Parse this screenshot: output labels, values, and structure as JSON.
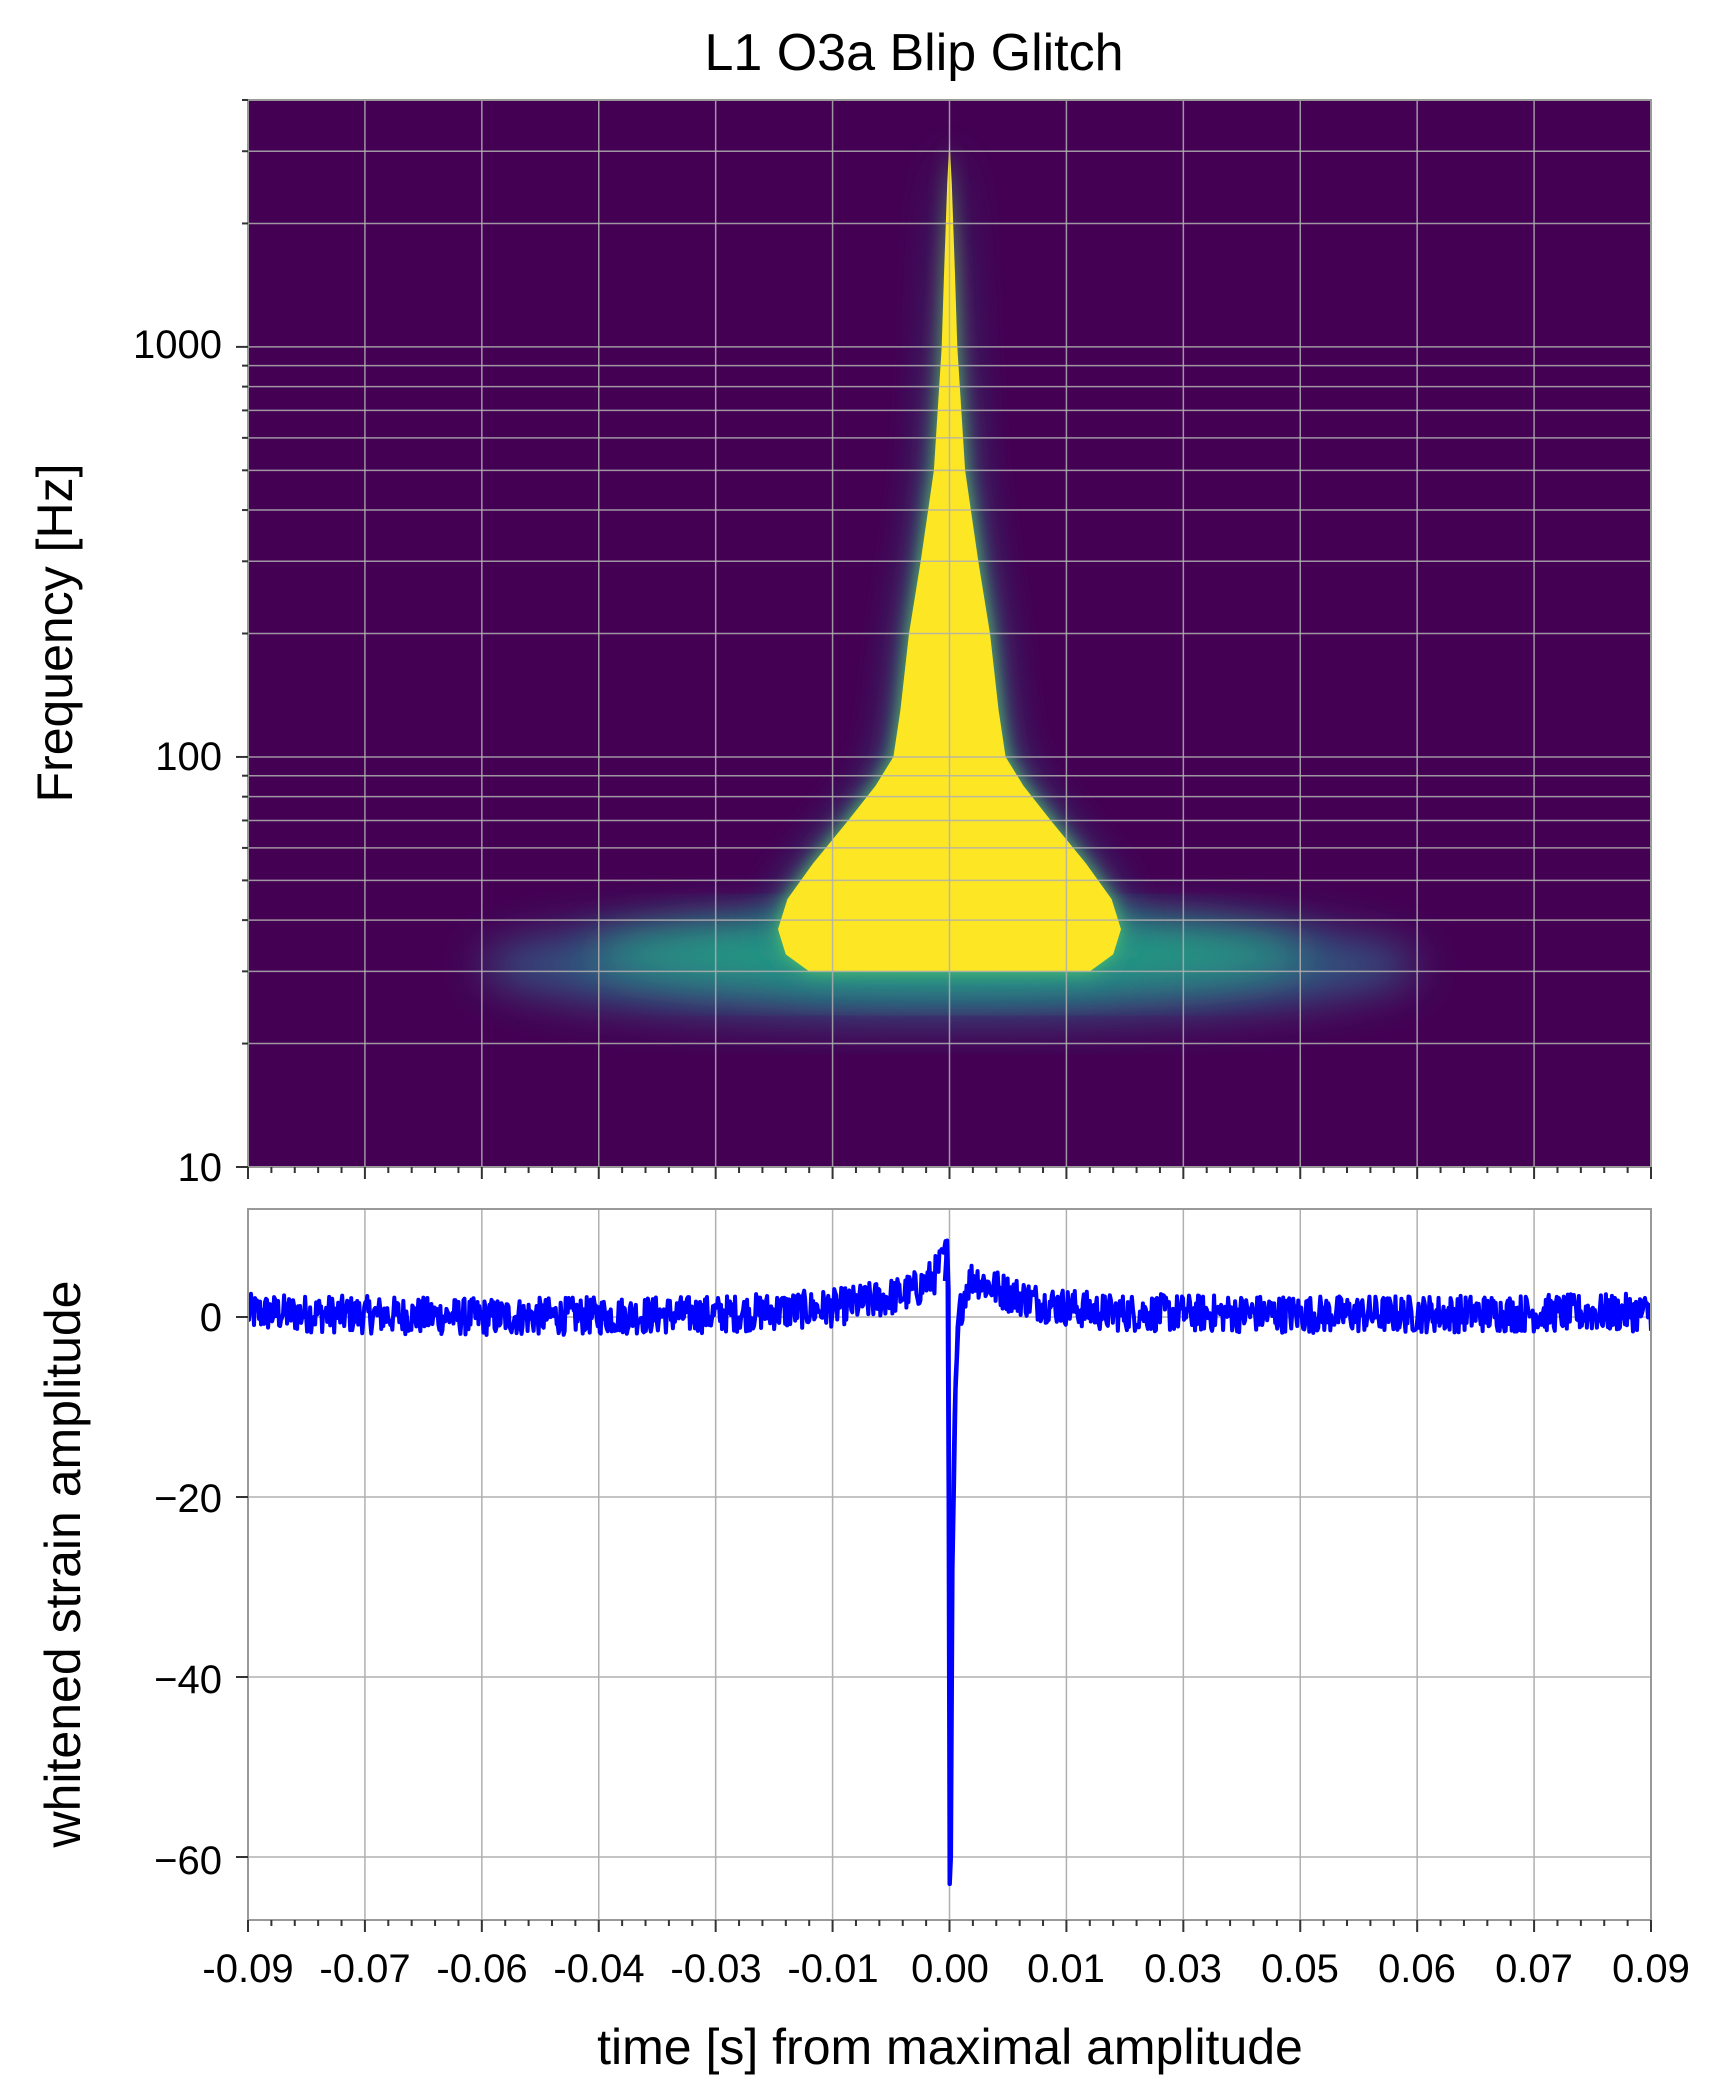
{
  "figure": {
    "title": "L1 O3a Blip Glitch",
    "xlabel": "time [s] from maximal amplitude",
    "x_ticks": [
      "-0.09",
      "-0.07",
      "-0.06",
      "-0.04",
      "-0.03",
      "-0.01",
      "0.00",
      "0.01",
      "0.03",
      "0.05",
      "0.06",
      "0.07",
      "0.09"
    ]
  },
  "chart_data": [
    {
      "type": "heatmap",
      "name": "spectrogram",
      "title": "L1 O3a Blip Glitch",
      "ylabel": "Frequency [Hz]",
      "y_scale": "log",
      "ylim": [
        10,
        4000
      ],
      "xlim": [
        -0.09,
        0.09
      ],
      "y_ticks": [
        "10",
        "100",
        "1000"
      ],
      "y_tick_values": [
        10,
        100,
        1000
      ],
      "grid": true,
      "colormap": "viridis",
      "background_color": "#440154",
      "peak_color": "#fde725",
      "glitch": {
        "center_time": 0.0,
        "saturated_region": [
          {
            "f": 2500,
            "half_width_s": 0.0003
          },
          {
            "f": 1500,
            "half_width_s": 0.0007
          },
          {
            "f": 1000,
            "half_width_s": 0.001
          },
          {
            "f": 500,
            "half_width_s": 0.002
          },
          {
            "f": 300,
            "half_width_s": 0.0037
          },
          {
            "f": 200,
            "half_width_s": 0.0052
          },
          {
            "f": 130,
            "half_width_s": 0.0063
          },
          {
            "f": 100,
            "half_width_s": 0.0072
          },
          {
            "f": 85,
            "half_width_s": 0.0095
          },
          {
            "f": 70,
            "half_width_s": 0.013
          },
          {
            "f": 55,
            "half_width_s": 0.0175
          },
          {
            "f": 45,
            "half_width_s": 0.0208
          },
          {
            "f": 38,
            "half_width_s": 0.022
          },
          {
            "f": 33,
            "half_width_s": 0.021
          },
          {
            "f": 30,
            "half_width_s": 0.018
          }
        ]
      }
    },
    {
      "type": "line",
      "name": "timeseries",
      "ylabel": "whitened strain amplitude",
      "xlim": [
        -0.09,
        0.09
      ],
      "ylim": [
        -67,
        12
      ],
      "y_ticks": [
        "0",
        "−20",
        "−40",
        "−60"
      ],
      "y_tick_values": [
        0,
        -20,
        -40,
        -60
      ],
      "grid": true,
      "line_color": "#0000ff",
      "series": [
        {
          "x": [
            -0.09,
            -0.06,
            -0.03,
            -0.015,
            -0.01,
            -0.006,
            -0.004,
            -0.002,
            -0.001,
            -0.0005,
            -0.0002,
            0.0,
            0.0003,
            0.0007,
            0.0012,
            0.002,
            0.003,
            0.005,
            0.008,
            0.012,
            0.02,
            0.05,
            0.09
          ],
          "values": [
            0.5,
            0.0,
            0.3,
            1.0,
            1.8,
            2.5,
            3.2,
            4.5,
            6.0,
            8.5,
            3.0,
            -63.0,
            -28.0,
            -8.0,
            0.0,
            3.0,
            4.5,
            3.5,
            2.5,
            1.5,
            0.5,
            0.3,
            0.5
          ]
        }
      ]
    }
  ]
}
